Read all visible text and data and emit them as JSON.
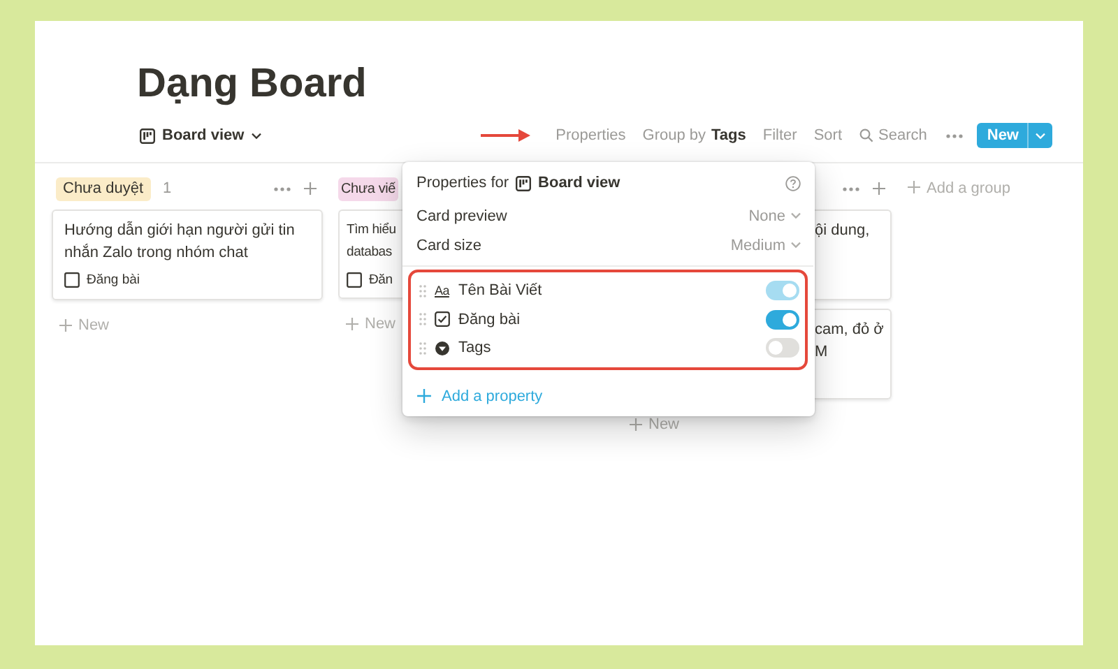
{
  "page": {
    "title": "Dạng Board"
  },
  "toolbar": {
    "view": "Board view",
    "items": [
      {
        "kind": "plain",
        "label": "Properties"
      },
      {
        "kind": "rich",
        "label": "Group by **Tags**"
      },
      {
        "kind": "plain",
        "label": "Filter"
      },
      {
        "kind": "plain",
        "label": "Sort"
      },
      {
        "kind": "search",
        "label": "Search"
      }
    ],
    "new_button": "New"
  },
  "columns": [
    {
      "tag": "Chưa duyệt",
      "color": "#fbecc8",
      "count": "1",
      "cards": [
        {
          "lines": [
            "Hướng dẫn giới hạn người gửi tin",
            "nhắn Zalo trong nhóm chat"
          ],
          "checkbox": {
            "label": "Đăng bài",
            "checked": false
          }
        }
      ],
      "new": "New"
    },
    {
      "tag": "Chưa viế",
      "color": "#f5d9ea",
      "cards": [
        {
          "lines": [
            "Tìm hiểu",
            "databas"
          ],
          "checkbox": {
            "label": "Đăn",
            "checked": false
          }
        }
      ],
      "new": "New"
    },
    {
      "cards": [
        {
          "lines": [
            "ội dung,"
          ]
        },
        {
          "lines": [
            "cam, đỏ ở",
            "M"
          ]
        }
      ],
      "new": "New"
    }
  ],
  "add_group": "Add a group",
  "popup": {
    "title": "Properties for",
    "view": "Board view",
    "settings": [
      {
        "label": "Card preview",
        "value": "None"
      },
      {
        "label": "Card size",
        "value": "Medium"
      }
    ],
    "properties": [
      {
        "kind": "text",
        "glyph": "Aa",
        "name": "Tên Bài Viết",
        "on": true,
        "disabled": true
      },
      {
        "kind": "checkbox",
        "name": "Đăng bài",
        "on": true,
        "disabled": false
      },
      {
        "kind": "tags",
        "name": "Tags",
        "on": false,
        "disabled": false
      }
    ],
    "add": "Add a property"
  }
}
